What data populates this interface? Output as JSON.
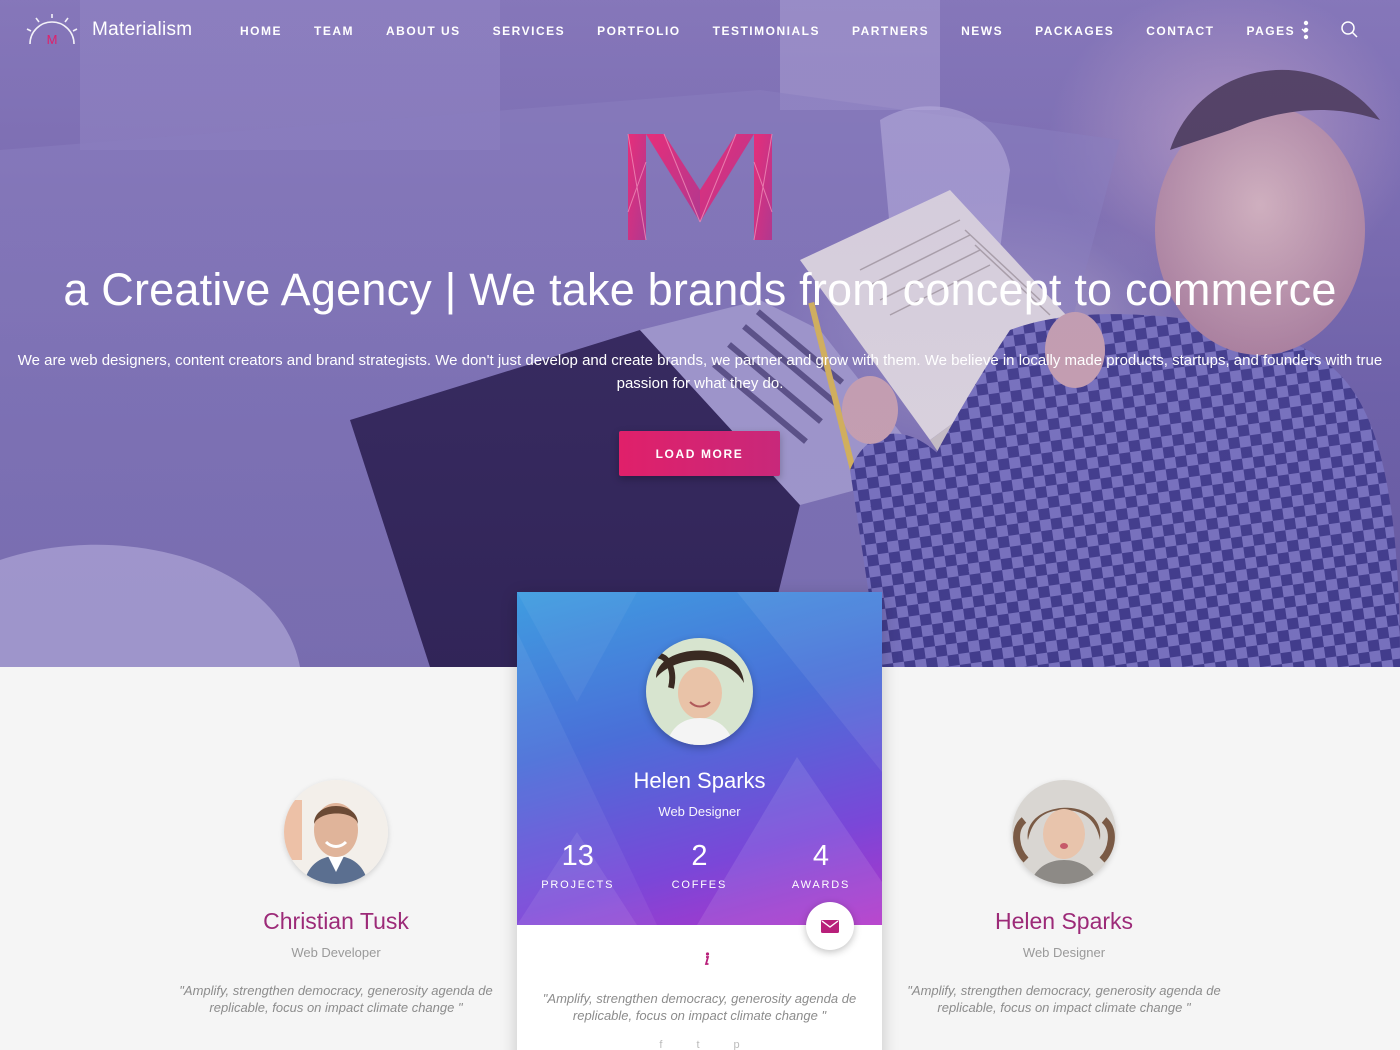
{
  "brand": {
    "name": "Materialism",
    "logo_letter": "M"
  },
  "nav": {
    "items": [
      "HOME",
      "TEAM",
      "ABOUT US",
      "SERVICES",
      "PORTFOLIO",
      "TESTIMONIALS",
      "PARTNERS",
      "NEWS",
      "PACKAGES",
      "CONTACT",
      "PAGES"
    ],
    "menu_icon": "vertical-dots-icon",
    "search_icon": "search-icon"
  },
  "hero": {
    "title": "a Creative Agency | We take brands from concept to commerce",
    "subtitle": "We are web designers, content creators and brand strategists. We don't just develop and create brands, we partner and grow with them. We believe in locally made products, startups, and founders with true passion for what they do.",
    "cta": "LOAD MORE"
  },
  "team": {
    "left": {
      "name": "Christian Tusk",
      "role": "Web Developer",
      "quote": "\"Amplify, strengthen democracy, generosity agenda de replicable, focus on impact climate change \""
    },
    "featured": {
      "name": "Helen Sparks",
      "role": "Web Designer",
      "stats": [
        {
          "value": "13",
          "label": "PROJECTS"
        },
        {
          "value": "2",
          "label": "COFFES"
        },
        {
          "value": "4",
          "label": "AWARDS"
        }
      ],
      "quote": "\"Amplify, strengthen democracy, generosity agenda de replicable, focus on impact climate change \"",
      "social": [
        "f",
        "t",
        "p"
      ]
    },
    "right": {
      "name": "Helen Sparks",
      "role": "Web Designer",
      "quote": "\"Amplify, strengthen democracy, generosity agenda de replicable, focus on impact climate change \""
    }
  },
  "colors": {
    "accent": "#e0206a",
    "name_color": "#9c2a78",
    "card_gradient_start": "#3f9de0",
    "card_gradient_end": "#b233c8"
  }
}
